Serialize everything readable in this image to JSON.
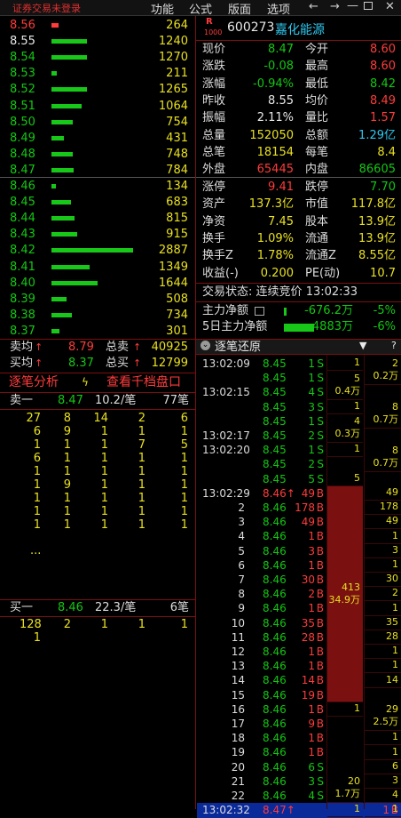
{
  "topbar": {
    "login_status": "证券交易未登录",
    "menu": [
      "功能",
      "公式",
      "版面",
      "选项"
    ],
    "nav_left": "←",
    "nav_right": "→"
  },
  "asks": [
    {
      "price": "8.56",
      "vol": "264",
      "fill": 0.09
    },
    {
      "price": "8.55",
      "vol": "1240",
      "fill": 0.43
    },
    {
      "price": "8.54",
      "vol": "1270",
      "fill": 0.44
    },
    {
      "price": "8.53",
      "vol": "211",
      "fill": 0.07
    },
    {
      "price": "8.52",
      "vol": "1265",
      "fill": 0.44
    },
    {
      "price": "8.51",
      "vol": "1064",
      "fill": 0.37
    },
    {
      "price": "8.50",
      "vol": "754",
      "fill": 0.26
    },
    {
      "price": "8.49",
      "vol": "431",
      "fill": 0.15
    },
    {
      "price": "8.48",
      "vol": "748",
      "fill": 0.26
    },
    {
      "price": "8.47",
      "vol": "784",
      "fill": 0.27
    }
  ],
  "bids": [
    {
      "price": "8.46",
      "vol": "134",
      "fill": 0.05
    },
    {
      "price": "8.45",
      "vol": "683",
      "fill": 0.24
    },
    {
      "price": "8.44",
      "vol": "815",
      "fill": 0.28
    },
    {
      "price": "8.43",
      "vol": "915",
      "fill": 0.32
    },
    {
      "price": "8.42",
      "vol": "2887",
      "fill": 1.0
    },
    {
      "price": "8.41",
      "vol": "1349",
      "fill": 0.47
    },
    {
      "price": "8.40",
      "vol": "1644",
      "fill": 0.57
    },
    {
      "price": "8.39",
      "vol": "508",
      "fill": 0.18
    },
    {
      "price": "8.38",
      "vol": "734",
      "fill": 0.25
    },
    {
      "price": "8.37",
      "vol": "301",
      "fill": 0.1
    }
  ],
  "avg": {
    "sell_avg_label": "卖均",
    "sell_avg": "8.79",
    "sell_total_label": "总卖",
    "sell_total": "40925",
    "buy_avg_label": "买均",
    "buy_avg": "8.37",
    "buy_total_label": "总买",
    "buy_total": "12799"
  },
  "analysis": {
    "label": "逐笔分析",
    "link": "查看千档盘口"
  },
  "sell1": {
    "label": "卖一",
    "price": "8.47",
    "per": "10.2/笔",
    "count": "77笔"
  },
  "sell_queue": [
    [
      "27",
      "8",
      "14",
      "2",
      "6"
    ],
    [
      "6",
      "9",
      "1",
      "1",
      "1"
    ],
    [
      "1",
      "1",
      "1",
      "7",
      "5"
    ],
    [
      "6",
      "1",
      "1",
      "1",
      "1"
    ],
    [
      "1",
      "1",
      "1",
      "1",
      "1"
    ],
    [
      "1",
      "9",
      "1",
      "1",
      "1"
    ],
    [
      "1",
      "1",
      "1",
      "1",
      "1"
    ],
    [
      "1",
      "1",
      "1",
      "1",
      "1"
    ],
    [
      "1",
      "1",
      "1",
      "1",
      "1"
    ]
  ],
  "sell_more": "...",
  "buy1": {
    "label": "买一",
    "price": "8.46",
    "per": "22.3/笔",
    "count": "6笔"
  },
  "buy_queue": [
    [
      "128",
      "2",
      "1",
      "1",
      "1"
    ],
    [
      "1",
      "",
      "",
      "",
      ""
    ]
  ],
  "stock": {
    "code": "600273",
    "name": "嘉化能源",
    "tag": "R"
  },
  "quote": [
    [
      "现价",
      "8.47",
      "今开",
      "8.60"
    ],
    [
      "涨跌",
      "-0.08",
      "最高",
      "8.60"
    ],
    [
      "涨幅",
      "-0.94%",
      "最低",
      "8.42"
    ],
    [
      "昨收",
      "8.55",
      "均价",
      "8.49"
    ],
    [
      "振幅",
      "2.11%",
      "量比",
      "1.57"
    ],
    [
      "总量",
      "152050",
      "总额",
      "1.29亿"
    ],
    [
      "总笔",
      "18154",
      "每笔",
      "8.4"
    ],
    [
      "外盘",
      "65445",
      "内盘",
      "86605"
    ]
  ],
  "quote2": [
    [
      "涨停",
      "9.41",
      "跌停",
      "7.70"
    ],
    [
      "资产",
      "137.3亿",
      "市值",
      "117.8亿"
    ],
    [
      "净资",
      "7.45",
      "股本",
      "13.9亿"
    ],
    [
      "换手",
      "1.09%",
      "流通",
      "13.9亿"
    ],
    [
      "换手Z",
      "1.78%",
      "流通Z",
      "8.55亿"
    ],
    [
      "收益(-)",
      "0.200",
      "PE(动)",
      "10.7"
    ]
  ],
  "trade_status": {
    "label": "交易状态:",
    "value": "连续竞价",
    "time": "13:02:33"
  },
  "main_flow": {
    "label": "主力净额",
    "value": "-676.2万",
    "pct": "-5%"
  },
  "flow5": {
    "label": "5日主力净额",
    "value": "-4883万",
    "pct": "-6%"
  },
  "ticks_title": "逐笔还原",
  "ticks": [
    {
      "t": "13:02:09",
      "p": "8.45",
      "v": "1",
      "s": "S",
      "c": "g"
    },
    {
      "t": "",
      "p": "8.45",
      "v": "1",
      "s": "S",
      "c": "g"
    },
    {
      "t": "13:02:15",
      "p": "8.45",
      "v": "4",
      "s": "S",
      "c": "g"
    },
    {
      "t": "",
      "p": "8.45",
      "v": "3",
      "s": "S",
      "c": "g"
    },
    {
      "t": "",
      "p": "8.45",
      "v": "1",
      "s": "S",
      "c": "g"
    },
    {
      "t": "13:02:17",
      "p": "8.45",
      "v": "2",
      "s": "S",
      "c": "g"
    },
    {
      "t": "13:02:20",
      "p": "8.45",
      "v": "1",
      "s": "S",
      "c": "g"
    },
    {
      "t": "",
      "p": "8.45",
      "v": "2",
      "s": "S",
      "c": "g"
    },
    {
      "t": "",
      "p": "8.45",
      "v": "5",
      "s": "S",
      "c": "g"
    },
    {
      "t": "13:02:29",
      "p": "8.46↑",
      "v": "49",
      "s": "B",
      "c": "r"
    },
    {
      "t": "2",
      "p": "8.46",
      "v": "178",
      "s": "B",
      "c": "r"
    },
    {
      "t": "3",
      "p": "8.46",
      "v": "49",
      "s": "B",
      "c": "r"
    },
    {
      "t": "4",
      "p": "8.46",
      "v": "1",
      "s": "B",
      "c": "r"
    },
    {
      "t": "5",
      "p": "8.46",
      "v": "3",
      "s": "B",
      "c": "r"
    },
    {
      "t": "6",
      "p": "8.46",
      "v": "1",
      "s": "B",
      "c": "r"
    },
    {
      "t": "7",
      "p": "8.46",
      "v": "30",
      "s": "B",
      "c": "r"
    },
    {
      "t": "8",
      "p": "8.46",
      "v": "2",
      "s": "B",
      "c": "r"
    },
    {
      "t": "9",
      "p": "8.46",
      "v": "1",
      "s": "B",
      "c": "r"
    },
    {
      "t": "10",
      "p": "8.46",
      "v": "35",
      "s": "B",
      "c": "r"
    },
    {
      "t": "11",
      "p": "8.46",
      "v": "28",
      "s": "B",
      "c": "r"
    },
    {
      "t": "12",
      "p": "8.46",
      "v": "1",
      "s": "B",
      "c": "r"
    },
    {
      "t": "13",
      "p": "8.46",
      "v": "1",
      "s": "B",
      "c": "r"
    },
    {
      "t": "14",
      "p": "8.46",
      "v": "14",
      "s": "B",
      "c": "r"
    },
    {
      "t": "15",
      "p": "8.46",
      "v": "19",
      "s": "B",
      "c": "r"
    },
    {
      "t": "16",
      "p": "8.46",
      "v": "1",
      "s": "B",
      "c": "r"
    },
    {
      "t": "17",
      "p": "8.46",
      "v": "9",
      "s": "B",
      "c": "r"
    },
    {
      "t": "18",
      "p": "8.46",
      "v": "1",
      "s": "B",
      "c": "r"
    },
    {
      "t": "19",
      "p": "8.46",
      "v": "1",
      "s": "B",
      "c": "r"
    },
    {
      "t": "20",
      "p": "8.46",
      "v": "6",
      "s": "S",
      "c": "g"
    },
    {
      "t": "21",
      "p": "8.46",
      "v": "3",
      "s": "S",
      "c": "g"
    },
    {
      "t": "22",
      "p": "8.46",
      "v": "4",
      "s": "S",
      "c": "g"
    },
    {
      "t": "13:02:32",
      "p": "8.47↑",
      "v": "1",
      "s": "B",
      "c": "r"
    }
  ],
  "agg1": [
    {
      "row": 0,
      "span": 1,
      "vol": "1"
    },
    {
      "row": 1,
      "span": 2,
      "vol": "5",
      "amt": "0.4万"
    },
    {
      "row": 3,
      "span": 1,
      "vol": "1"
    },
    {
      "row": 4,
      "span": 2,
      "vol": "4",
      "amt": "0.3万"
    },
    {
      "row": 6,
      "span": 1,
      "vol": "1"
    },
    {
      "row": 7,
      "span": 2,
      "vol": "5"
    },
    {
      "row": 9,
      "span": 15,
      "vol": "413",
      "amt": "34.9万",
      "hl": true
    },
    {
      "row": 24,
      "span": 1,
      "vol": "1"
    },
    {
      "row": 25,
      "span": 6,
      "vol": "20",
      "amt": "1.7万"
    },
    {
      "row": 31,
      "span": 1,
      "vol": "1"
    }
  ],
  "agg2": [
    {
      "row": 0,
      "span": 2,
      "vol": "2",
      "amt": "0.2万"
    },
    {
      "row": 2,
      "span": 3,
      "vol": "8",
      "amt": "0.7万"
    },
    {
      "row": 5,
      "span": 3,
      "vol": "8",
      "amt": "0.7万"
    },
    {
      "row": 9,
      "span": 1,
      "vol": "49"
    },
    {
      "row": 10,
      "span": 1,
      "vol": "178"
    },
    {
      "row": 11,
      "span": 1,
      "vol": "49"
    },
    {
      "row": 12,
      "span": 1,
      "vol": "1"
    },
    {
      "row": 13,
      "span": 1,
      "vol": "3"
    },
    {
      "row": 14,
      "span": 1,
      "vol": "1"
    },
    {
      "row": 15,
      "span": 1,
      "vol": "30"
    },
    {
      "row": 16,
      "span": 1,
      "vol": "2"
    },
    {
      "row": 17,
      "span": 1,
      "vol": "1"
    },
    {
      "row": 18,
      "span": 1,
      "vol": "35"
    },
    {
      "row": 19,
      "span": 1,
      "vol": "28"
    },
    {
      "row": 20,
      "span": 1,
      "vol": "1"
    },
    {
      "row": 21,
      "span": 1,
      "vol": "1"
    },
    {
      "row": 22,
      "span": 1,
      "vol": "14"
    },
    {
      "row": 23,
      "span": 3,
      "vol": "29",
      "amt": "2.5万"
    },
    {
      "row": 26,
      "span": 1,
      "vol": "1"
    },
    {
      "row": 27,
      "span": 1,
      "vol": "1"
    },
    {
      "row": 28,
      "span": 1,
      "vol": "6"
    },
    {
      "row": 29,
      "span": 1,
      "vol": "3"
    },
    {
      "row": 30,
      "span": 1,
      "vol": "4"
    },
    {
      "row": 31,
      "span": 1,
      "vol": "1"
    }
  ],
  "colors": {
    "up": "#ff3b3b",
    "down": "#12c812",
    "neutral": "#e8e020",
    "hl": "#7a1010",
    "sel": "#0a2a9a"
  }
}
